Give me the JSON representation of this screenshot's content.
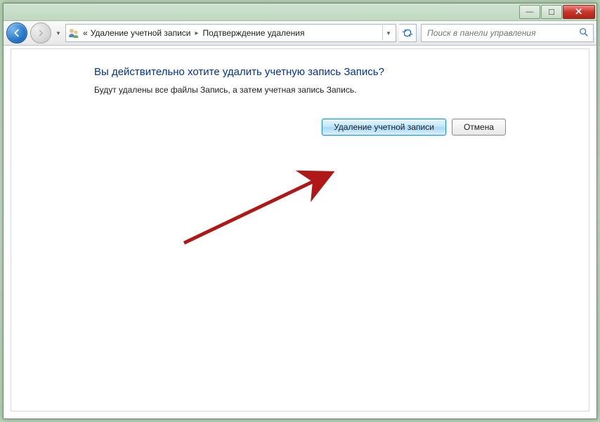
{
  "titlebar": {
    "minimize": "—",
    "maximize": "☐",
    "close": "X"
  },
  "breadcrumb": {
    "prefix": "«",
    "item1": "Удаление учетной записи",
    "item2": "Подтверждение удаления"
  },
  "search": {
    "placeholder": "Поиск в панели управления"
  },
  "main": {
    "heading": "Вы действительно хотите удалить учетную запись Запись?",
    "body": "Будут удалены все файлы Запись, а затем учетная запись Запись.",
    "delete_btn": "Удаление учетной записи",
    "cancel_btn": "Отмена"
  }
}
